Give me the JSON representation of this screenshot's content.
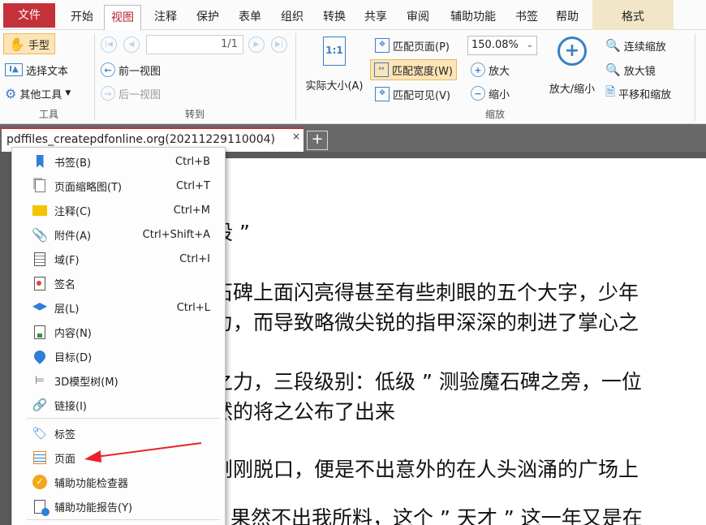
{
  "menubar": {
    "tabs": [
      "文件",
      "开始",
      "视图",
      "注释",
      "保护",
      "表单",
      "组织",
      "转换",
      "共享",
      "审阅",
      "辅助功能",
      "书签",
      "帮助",
      "格式"
    ],
    "active": "视图"
  },
  "ribbon": {
    "tools": {
      "hand": "手型",
      "select_text": "选择文本",
      "other_tools": "其他工具",
      "label": "工具"
    },
    "goto": {
      "page_value": "1/1",
      "prev_view": "前一视图",
      "next_view": "后一视图",
      "label": "转到"
    },
    "zoom": {
      "actual_size": "实际大小(A)",
      "fit_page": "匹配页面(P)",
      "fit_width": "匹配宽度(W)",
      "fit_visible": "匹配可见(V)",
      "zoom_value": "150.08%",
      "zoom_in": "放大",
      "zoom_out": "缩小",
      "zoom_in_out": "放大/缩小",
      "continuous_zoom": "连续缩放",
      "magnifier": "放大镜",
      "pan_zoom": "平移和缩放",
      "label": "缩放"
    }
  },
  "tabbar": {
    "doc_tab": "pdffiles_createpdfonline.org(20211229110004)",
    "close": "×",
    "add": "+"
  },
  "document": {
    "lines": [
      "段 ”",
      "石碑上面闪亮得甚至有些刺眼的五个大字，少年",
      "力，而导致略微尖锐的指甲深深的刺进了掌心之",
      "之力，三段级别：低级 ” 测验魔石碑之旁，一位",
      "然的将之公布了出来",
      "刚刚脱口，便是不出意外的在人头汹涌的广场上",
      "果然不出我所料，这个 ” 天才 ” 这一年又是在"
    ]
  },
  "context_menu": {
    "items": [
      {
        "label": "书签(B)",
        "shortcut": "Ctrl+B",
        "icon": "bookmark-icon"
      },
      {
        "label": "页面缩略图(T)",
        "shortcut": "Ctrl+T",
        "icon": "thumbnail-icon"
      },
      {
        "label": "注释(C)",
        "shortcut": "Ctrl+M",
        "icon": "comment-icon"
      },
      {
        "label": "附件(A)",
        "shortcut": "Ctrl+Shift+A",
        "icon": "paperclip-icon"
      },
      {
        "label": "域(F)",
        "shortcut": "Ctrl+I",
        "icon": "field-icon"
      },
      {
        "label": "签名",
        "shortcut": "",
        "icon": "signature-icon"
      },
      {
        "label": "层(L)",
        "shortcut": "Ctrl+L",
        "icon": "layers-icon"
      },
      {
        "label": "内容(N)",
        "shortcut": "",
        "icon": "content-icon"
      },
      {
        "label": "目标(D)",
        "shortcut": "",
        "icon": "destination-icon"
      },
      {
        "label": "3D模型树(M)",
        "shortcut": "",
        "icon": "model-tree-icon"
      },
      {
        "label": "链接(I)",
        "shortcut": "",
        "icon": "link-icon"
      }
    ],
    "items2": [
      {
        "label": "标签",
        "icon": "tag-icon"
      },
      {
        "label": "页面",
        "icon": "page-icon"
      },
      {
        "label": "辅助功能检查器",
        "icon": "accessibility-checker-icon"
      },
      {
        "label": "辅助功能报告(Y)",
        "icon": "accessibility-report-icon"
      }
    ]
  },
  "colors": {
    "accent": "#c3313b",
    "arrow": "#e8232a",
    "selected": "#fde4b6"
  }
}
